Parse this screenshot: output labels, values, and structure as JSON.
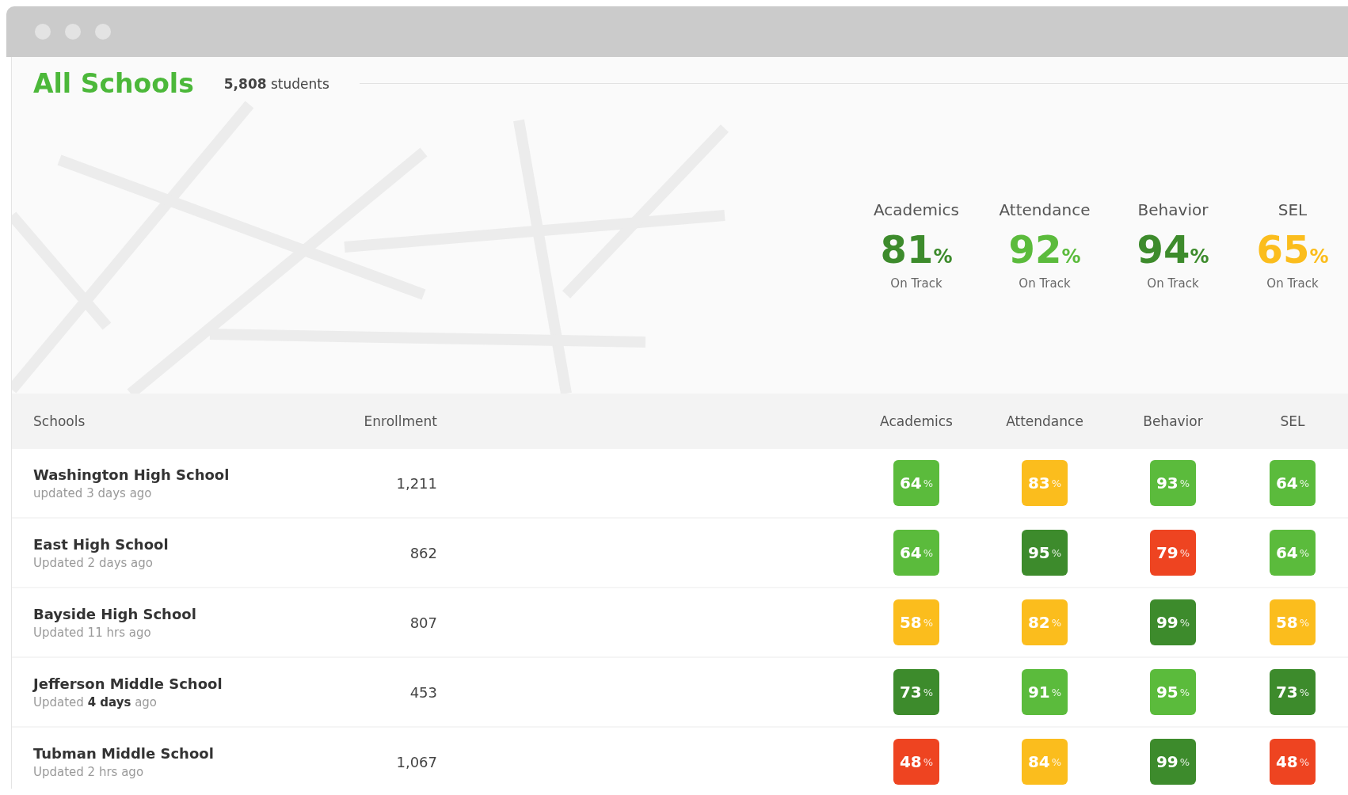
{
  "header": {
    "title": "All Schools",
    "count": "5,808",
    "count_label": "students"
  },
  "summary": [
    {
      "label": "Academics",
      "value": "81",
      "unit": "%",
      "caption": "On Track",
      "color": "#3d8b2c"
    },
    {
      "label": "Attendance",
      "value": "92",
      "unit": "%",
      "caption": "On Track",
      "color": "#5bbb3c"
    },
    {
      "label": "Behavior",
      "value": "94",
      "unit": "%",
      "caption": "On Track",
      "color": "#3d8b2c"
    },
    {
      "label": "SEL",
      "value": "65",
      "unit": "%",
      "caption": "On Track",
      "color": "#fbbd1d"
    }
  ],
  "table": {
    "columns": [
      "Schools",
      "Enrollment",
      "Academics",
      "Attendance",
      "Behavior",
      "SEL"
    ],
    "rows": [
      {
        "name": "Washington High School",
        "updated": "updated 3 days ago",
        "enrollment": "1,211",
        "scores": [
          {
            "value": "64",
            "unit": "%",
            "color": "#5bbb3c"
          },
          {
            "value": "83",
            "unit": "%",
            "color": "#fbbd1d"
          },
          {
            "value": "93",
            "unit": "%",
            "color": "#5bbb3c"
          },
          {
            "value": "64",
            "unit": "%",
            "color": "#5bbb3c"
          }
        ]
      },
      {
        "name": "East High School",
        "updated": "Updated 2 days ago",
        "enrollment": "862",
        "scores": [
          {
            "value": "64",
            "unit": "%",
            "color": "#5bbb3c"
          },
          {
            "value": "95",
            "unit": "%",
            "color": "#3d8b2c"
          },
          {
            "value": "79",
            "unit": "%",
            "color": "#ee4421"
          },
          {
            "value": "64",
            "unit": "%",
            "color": "#5bbb3c"
          }
        ]
      },
      {
        "name": "Bayside High School",
        "updated": "Updated 11 hrs ago",
        "enrollment": "807",
        "scores": [
          {
            "value": "58",
            "unit": "%",
            "color": "#fbbd1d"
          },
          {
            "value": "82",
            "unit": "%",
            "color": "#fbbd1d"
          },
          {
            "value": "99",
            "unit": "%",
            "color": "#3d8b2c"
          },
          {
            "value": "58",
            "unit": "%",
            "color": "#fbbd1d"
          }
        ]
      },
      {
        "name": "Jefferson Middle School",
        "updated": "Updated **4 days** ago",
        "enrollment": "453",
        "scores": [
          {
            "value": "73",
            "unit": "%",
            "color": "#3d8b2c"
          },
          {
            "value": "91",
            "unit": "%",
            "color": "#5bbb3c"
          },
          {
            "value": "95",
            "unit": "%",
            "color": "#5bbb3c"
          },
          {
            "value": "73",
            "unit": "%",
            "color": "#3d8b2c"
          }
        ]
      },
      {
        "name": "Tubman Middle School",
        "updated": "Updated 2 hrs ago",
        "enrollment": "1,067",
        "scores": [
          {
            "value": "48",
            "unit": "%",
            "color": "#ee4421"
          },
          {
            "value": "84",
            "unit": "%",
            "color": "#fbbd1d"
          },
          {
            "value": "99",
            "unit": "%",
            "color": "#3d8b2c"
          },
          {
            "value": "48",
            "unit": "%",
            "color": "#ee4421"
          }
        ]
      }
    ]
  }
}
